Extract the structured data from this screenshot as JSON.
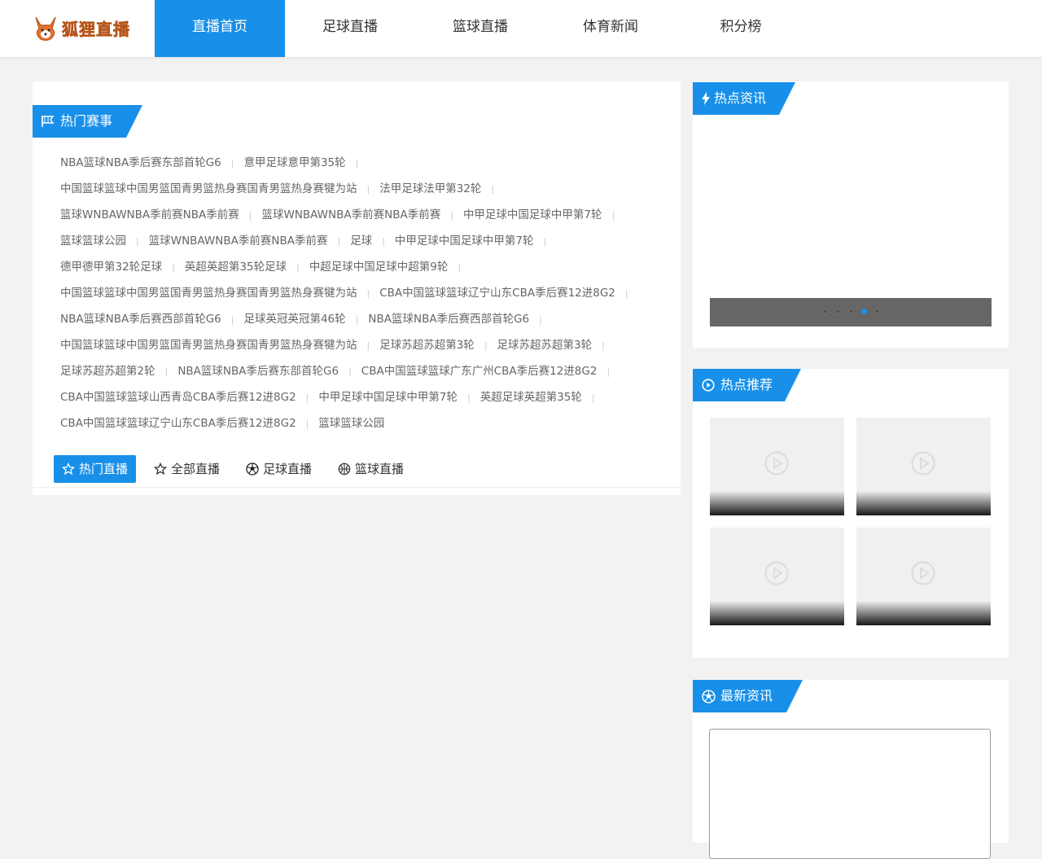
{
  "header": {
    "logo_text": "狐狸直播",
    "nav": [
      {
        "label": "直播首页",
        "active": true
      },
      {
        "label": "足球直播",
        "active": false
      },
      {
        "label": "篮球直播",
        "active": false
      },
      {
        "label": "体育新闻",
        "active": false
      },
      {
        "label": "积分榜",
        "active": false
      }
    ]
  },
  "hot_matches": {
    "title": "热门赛事",
    "lines": [
      [
        "NBA篮球NBA季后赛东部首轮G6",
        "意甲足球意甲第35轮"
      ],
      [
        "中国篮球篮球中国男篮国青男篮热身赛国青男篮热身赛犍为站",
        "法甲足球法甲第32轮"
      ],
      [
        "篮球WNBAWNBA季前赛NBA季前赛",
        "篮球WNBAWNBA季前赛NBA季前赛",
        "中甲足球中国足球中甲第7轮"
      ],
      [
        "篮球篮球公园",
        "篮球WNBAWNBA季前赛NBA季前赛",
        "足球",
        "中甲足球中国足球中甲第7轮"
      ],
      [
        "德甲德甲第32轮足球",
        "英超英超第35轮足球",
        "中超足球中国足球中超第9轮"
      ],
      [
        "中国篮球篮球中国男篮国青男篮热身赛国青男篮热身赛犍为站",
        "CBA中国篮球篮球辽宁山东CBA季后赛12进8G2"
      ],
      [
        "NBA篮球NBA季后赛西部首轮G6",
        "足球英冠英冠第46轮",
        "NBA篮球NBA季后赛西部首轮G6"
      ],
      [
        "中国篮球篮球中国男篮国青男篮热身赛国青男篮热身赛犍为站",
        "足球苏超苏超第3轮",
        "足球苏超苏超第3轮"
      ],
      [
        "足球苏超苏超第2轮",
        "NBA篮球NBA季后赛东部首轮G6",
        "CBA中国篮球篮球广东广州CBA季后赛12进8G2"
      ],
      [
        "CBA中国篮球篮球山西青岛CBA季后赛12进8G2",
        "中甲足球中国足球中甲第7轮",
        "英超足球英超第35轮"
      ],
      [
        "CBA中国篮球篮球辽宁山东CBA季后赛12进8G2",
        "篮球篮球公园"
      ]
    ],
    "trailing_sep": [
      true,
      true,
      true,
      true,
      true,
      true,
      true,
      true,
      true,
      true,
      false
    ],
    "separator": "|"
  },
  "tabs": [
    {
      "label": "热门直播",
      "icon": "star-outline-icon",
      "active": true
    },
    {
      "label": "全部直播",
      "icon": "star-outline-icon",
      "active": false
    },
    {
      "label": "足球直播",
      "icon": "soccer-ball-icon",
      "active": false
    },
    {
      "label": "篮球直播",
      "icon": "basketball-icon",
      "active": false
    }
  ],
  "sidebar": {
    "hot_news": {
      "title": "热点资讯",
      "icon": "lightning-icon",
      "carousel_dots": 5,
      "active_dot": 3
    },
    "recommend": {
      "title": "热点推荐",
      "icon": "play-circle-icon",
      "thumbs": 4
    },
    "latest": {
      "title": "最新资讯",
      "icon": "soccer-ball-icon"
    }
  },
  "colors": {
    "accent": "#1890e9",
    "background": "#f2f2f2",
    "logo": "#e8722b"
  }
}
